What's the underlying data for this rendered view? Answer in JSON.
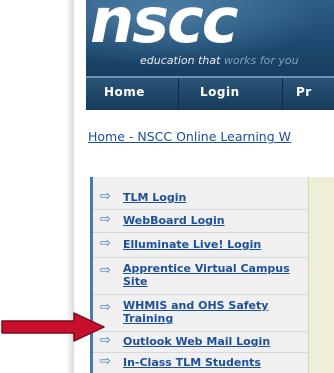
{
  "brand": {
    "logo_text": "nscc",
    "tagline_prefix": "education that ",
    "tagline_highlight": "works for you"
  },
  "nav": {
    "items": [
      {
        "label": "Home"
      },
      {
        "label": "Login"
      },
      {
        "label": "Pr"
      }
    ]
  },
  "breadcrumb": {
    "text": "Home - NSCC Online Learning W"
  },
  "menu": {
    "items": [
      {
        "label": "TLM Login"
      },
      {
        "label": "WebBoard Login"
      },
      {
        "label": "Elluminate Live! Login"
      },
      {
        "label": "Apprentice Virtual Campus Site"
      },
      {
        "label": "WHMIS and OHS Safety Training"
      },
      {
        "label": "Outlook Web Mail Login"
      },
      {
        "label": "In-Class TLM Students"
      }
    ],
    "arrow_glyph": "⇨"
  },
  "colors": {
    "banner": "#1d4a70",
    "link": "#1e4f9a",
    "pointer_arrow": "#c8102e"
  }
}
